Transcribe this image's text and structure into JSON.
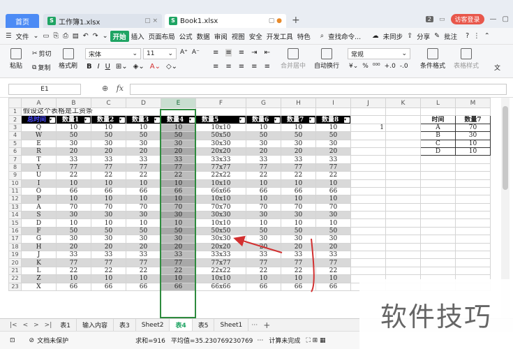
{
  "tabs": {
    "home": "首页",
    "file1": "工作簿1.xlsx",
    "file2": "Book1.xlsx",
    "badge": "2",
    "visitor": "访客登录"
  },
  "menu": {
    "file": "文件",
    "start": "开始",
    "items": [
      "插入",
      "页面布局",
      "公式",
      "数据",
      "审阅",
      "视图",
      "安全",
      "开发工具",
      "特色"
    ],
    "search": "查找命令...",
    "unsync": "未同步",
    "share": "分享",
    "comment": "批注"
  },
  "ribbon": {
    "paste": "粘贴",
    "cut": "剪切",
    "copy": "复制",
    "format_painter": "格式刷",
    "font_name": "宋体",
    "font_size": "11",
    "number_format": "常规",
    "merge": "合并居中",
    "wrap": "自动换行",
    "cond_format": "条件格式",
    "table_style": "表格样式",
    "text": "文"
  },
  "formula_bar": {
    "cell_ref": "E1",
    "fx": "fx",
    "content": ""
  },
  "grid": {
    "columns": [
      "A",
      "B",
      "C",
      "D",
      "E",
      "F",
      "G",
      "H",
      "I",
      "J",
      "K",
      "L",
      "M"
    ],
    "title": "假设这个表格是工资条",
    "headers": [
      "总时间",
      "数量1",
      "数量2",
      "数量3",
      "数量4",
      "数量5",
      "数量6",
      "数量7",
      "数量8"
    ],
    "rows": [
      [
        "Q",
        "10",
        "10",
        "10",
        "10",
        "10x10",
        "10",
        "10",
        "10"
      ],
      [
        "W",
        "50",
        "50",
        "50",
        "50",
        "50x50",
        "50",
        "50",
        "50"
      ],
      [
        "E",
        "30",
        "30",
        "30",
        "30",
        "30x30",
        "30",
        "30",
        "30"
      ],
      [
        "R",
        "20",
        "20",
        "20",
        "20",
        "20x20",
        "20",
        "20",
        "20"
      ],
      [
        "T",
        "33",
        "33",
        "33",
        "33",
        "33x33",
        "33",
        "33",
        "33"
      ],
      [
        "Y",
        "77",
        "77",
        "77",
        "77",
        "77x77",
        "77",
        "77",
        "77"
      ],
      [
        "U",
        "22",
        "22",
        "22",
        "22",
        "22x22",
        "22",
        "22",
        "22"
      ],
      [
        "I",
        "10",
        "10",
        "10",
        "10",
        "10x10",
        "10",
        "10",
        "10"
      ],
      [
        "O",
        "66",
        "66",
        "66",
        "66",
        "66x66",
        "66",
        "66",
        "66"
      ],
      [
        "P",
        "10",
        "10",
        "10",
        "10",
        "10x10",
        "10",
        "10",
        "10"
      ],
      [
        "A",
        "70",
        "70",
        "70",
        "70",
        "70x70",
        "70",
        "70",
        "70"
      ],
      [
        "S",
        "30",
        "30",
        "30",
        "30",
        "30x30",
        "30",
        "30",
        "30"
      ],
      [
        "D",
        "10",
        "10",
        "10",
        "10",
        "10x10",
        "10",
        "10",
        "10"
      ],
      [
        "F",
        "50",
        "50",
        "50",
        "50",
        "50x50",
        "50",
        "50",
        "50"
      ],
      [
        "G",
        "30",
        "30",
        "30",
        "30",
        "30x30",
        "30",
        "30",
        "30"
      ],
      [
        "H",
        "20",
        "20",
        "20",
        "20",
        "20x20",
        "20",
        "20",
        "20"
      ],
      [
        "J",
        "33",
        "33",
        "33",
        "33",
        "33x33",
        "33",
        "33",
        "33"
      ],
      [
        "K",
        "77",
        "77",
        "77",
        "77",
        "77x77",
        "77",
        "77",
        "77"
      ],
      [
        "L",
        "22",
        "22",
        "22",
        "22",
        "22x22",
        "22",
        "22",
        "22"
      ],
      [
        "Z",
        "10",
        "10",
        "10",
        "10",
        "10x10",
        "10",
        "10",
        "10"
      ],
      [
        "X",
        "66",
        "66",
        "66",
        "66",
        "66x66",
        "66",
        "66",
        "66"
      ]
    ],
    "j3": "1",
    "lookup": {
      "headers": [
        "时间",
        "数量7"
      ],
      "rows": [
        [
          "A",
          "70"
        ],
        [
          "B",
          "30"
        ],
        [
          "C",
          "10"
        ],
        [
          "D",
          "10"
        ]
      ]
    }
  },
  "sheets": [
    "表1",
    "输入内容",
    "表3",
    "Sheet2",
    "表4",
    "表5",
    "Sheet1"
  ],
  "active_sheet": "表4",
  "status": {
    "protect": "文档未保护",
    "sum": "求和=916",
    "avg": "平均值=35.230769230769",
    "calc": "计算未完成"
  },
  "watermark": "软件技巧",
  "colors": {
    "accent": "#1fa463",
    "selection": "#2e8b3e",
    "arrow": "#d23030"
  }
}
